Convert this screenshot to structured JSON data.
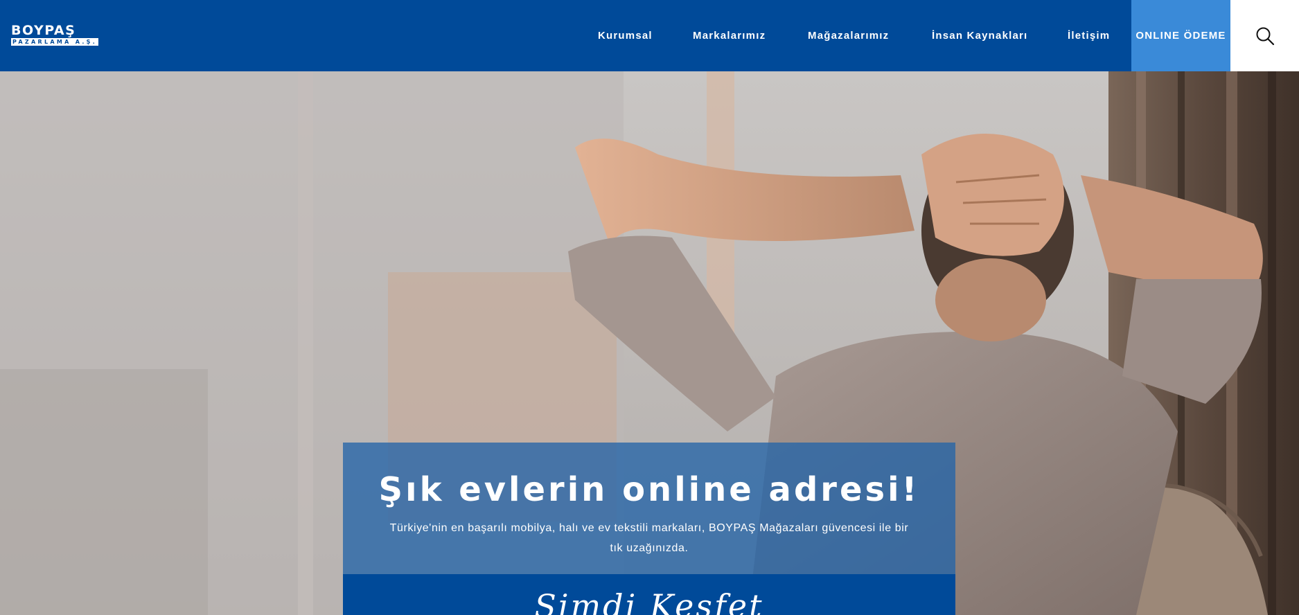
{
  "brand": {
    "name": "BOYPAŞ",
    "subtitle": "PAZARLAMA A.Ş."
  },
  "nav": {
    "items": [
      {
        "label": "Kurumsal"
      },
      {
        "label": "Markalarımız"
      },
      {
        "label": "Mağazalarımız"
      },
      {
        "label": "İnsan Kaynakları"
      },
      {
        "label": "İletişim"
      }
    ],
    "online_payment_label": "ONLINE ÖDEME",
    "search_icon": "search-icon"
  },
  "hero": {
    "title": "Şık evlerin online adresi!",
    "description": "Türkiye'nin en başarılı mobilya, halı ve ev tekstili markaları, BOYPAŞ Mağazaları güvencesi ile bir tık uzağınızda.",
    "cta_label": "Şimdi Keşfet"
  },
  "colors": {
    "primary": "#004a99",
    "accent": "#3a8ad8",
    "promo_overlay": "#2464a8"
  }
}
